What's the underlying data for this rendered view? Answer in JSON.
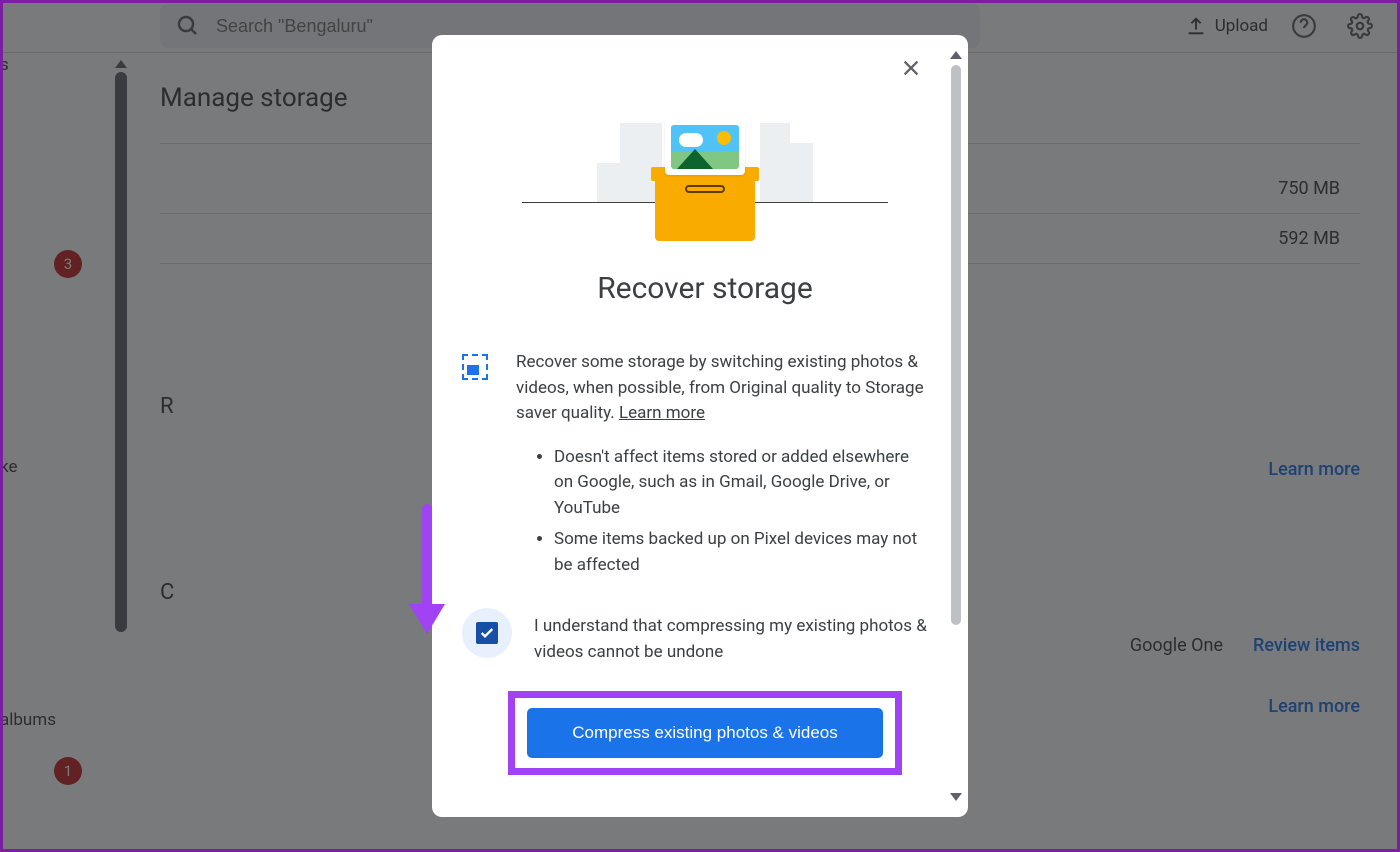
{
  "topbar": {
    "search_placeholder": "Search \"Bengaluru\"",
    "upload_label": "Upload"
  },
  "page": {
    "title": "Manage storage",
    "storage_rows": [
      {
        "size": "750 MB"
      },
      {
        "size": "592 MB"
      }
    ],
    "learn_more": "Learn more",
    "review_items": "Review items",
    "google_one": "Google One",
    "section_r": "R",
    "section_c": "C"
  },
  "sidebar": {
    "partial_s": "s",
    "partial_ke": "ke",
    "partial_albums": "albums",
    "badge_3": "3",
    "badge_1": "1"
  },
  "modal": {
    "title": "Recover storage",
    "description": "Recover some storage by switching existing photos & videos, when possible, from Original quality to Storage saver quality. ",
    "learn_more": "Learn more",
    "bullets": [
      "Doesn't affect items stored or added elsewhere on Google, such as in Gmail, Google Drive, or YouTube",
      "Some items backed up on Pixel devices may not be affected"
    ],
    "checkbox_label": "I understand that compressing my existing photos & videos cannot be undone",
    "button_label": "Compress existing photos & videos"
  }
}
